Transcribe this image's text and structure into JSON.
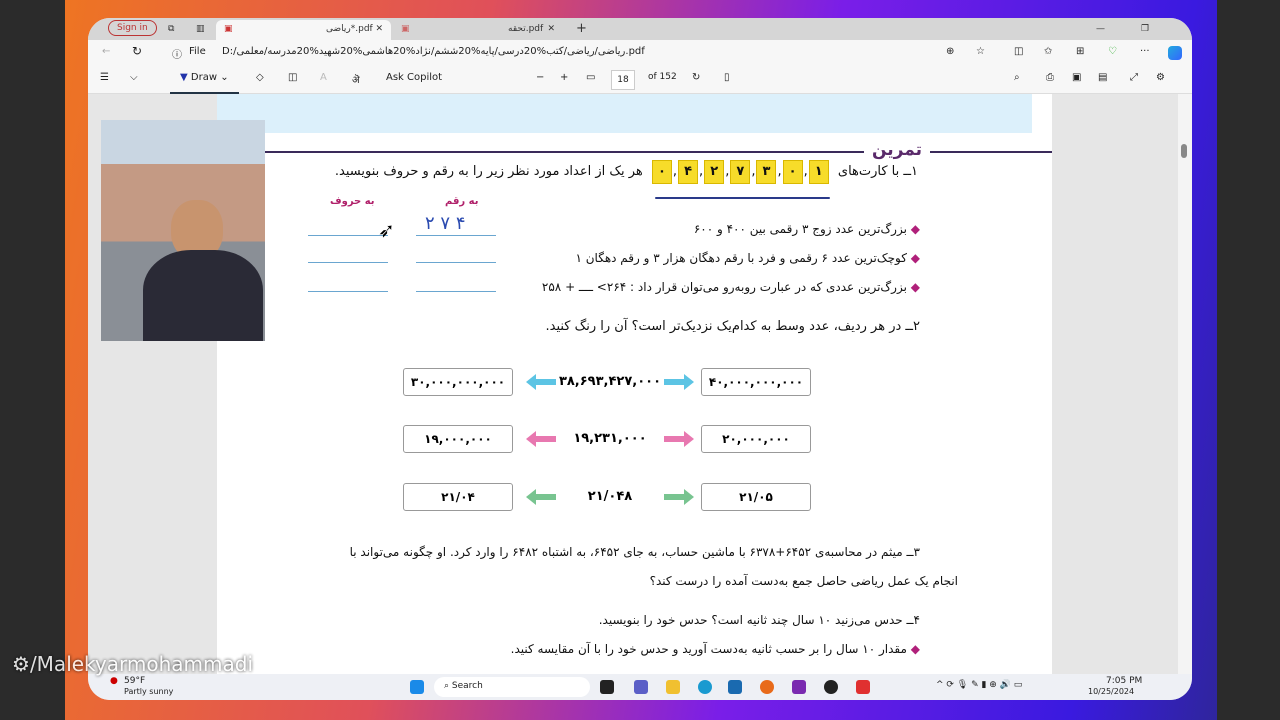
{
  "browser": {
    "sign_in": "Sign in",
    "tabs": [
      {
        "label": "ریاضی*.pdf"
      },
      {
        "label": "تحقه.pdf"
      }
    ],
    "file_label": "File",
    "url": "D:/ریاضی/ریاضی/کتب%20درسی/پایه%20ششم/نژاد%20هاشمی%20شهید%20مدرسه/معلمی.pdf"
  },
  "pdf_toolbar": {
    "draw_label": "Draw",
    "ask_copilot": "Ask Copilot",
    "page_number": "18",
    "page_total": "of 152"
  },
  "page": {
    "section_title": "تمرین",
    "q1": {
      "prefix": "۱ــ با کارت‌های",
      "suffix": "هر یک از اعداد مورد نظر زیر را به رقم و حروف بنویسید.",
      "cards": [
        "۰",
        "۴",
        "۲",
        "۷",
        "۳",
        "۰",
        "۱"
      ],
      "col_digits": "به رقم",
      "col_words": "به حروف",
      "handwritten_answer": "۴ ۷ ۲",
      "items": [
        "بزرگ‌ترین عدد زوج ۳ رقمی بین ۴۰۰ و ۶۰۰",
        "کوچک‌ترین عدد ۶ رقمی و فرد با رقم دهگان هزار ۳ و رقم دهگان ۱",
        "بزرگ‌ترین عددی که در عبارت روبه‌رو می‌توان قرار داد : ۲۶۴> ــــ + ۲۵۸"
      ]
    },
    "q2": {
      "text": "۲ــ در هر ردیف، عدد وسط به کدام‌یک نزدیک‌تر است؟ آن را رنگ کنید.",
      "rows": [
        {
          "left": "۳۰,۰۰۰,۰۰۰,۰۰۰",
          "middle": "۳۸,۶۹۳,۴۲۷,۰۰۰",
          "right": "۴۰,۰۰۰,۰۰۰,۰۰۰",
          "color": "#5cc4e4"
        },
        {
          "left": "۱۹,۰۰۰,۰۰۰",
          "middle": "۱۹,۲۳۱,۰۰۰",
          "right": "۲۰,۰۰۰,۰۰۰",
          "color": "#e878b0"
        },
        {
          "left": "۲۱/۰۴",
          "middle": "۲۱/۰۴۸",
          "right": "۲۱/۰۵",
          "color": "#78c490"
        }
      ]
    },
    "q3": {
      "line1": "۳ــ میثم در محاسبه‌ی ۶۴۵۲+۶۳۷۸ با ماشین حساب، به جای ۶۴۵۲، به اشتباه ۶۴۸۲ را وارد کرد. او چگونه می‌تواند با",
      "line2": "انجام یک عمل ریاضی حاصل جمع به‌دست آمده را درست کند؟"
    },
    "q4": {
      "line1": "۴ــ حدس می‌زنید ۱۰ سال چند ثانیه است؟ حدس خود را بنویسید.",
      "line2": "مقدار ۱۰ سال را بر حسب ثانیه به‌دست آورید و حدس خود را با آن مقایسه کنید."
    }
  },
  "taskbar": {
    "temp": "59°F",
    "weather": "Partly sunny",
    "search": "Search",
    "time": "7:05 PM",
    "date": "10/25/2024"
  },
  "watermark": "/Malekyarmohammadi"
}
